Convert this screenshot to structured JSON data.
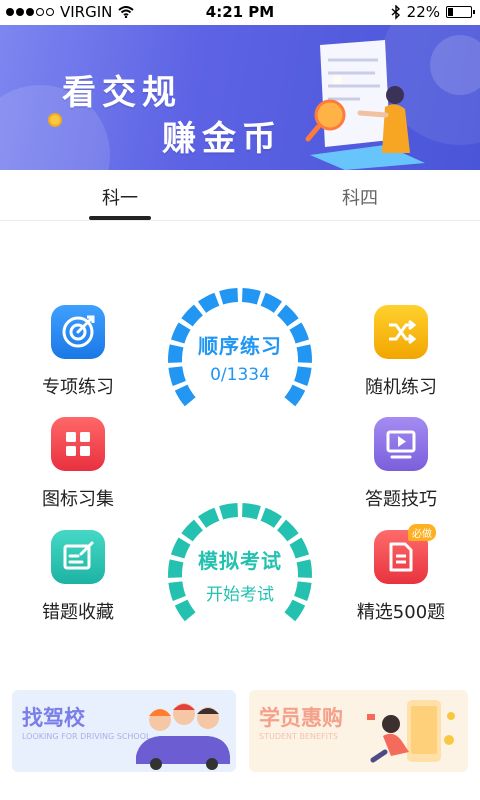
{
  "status_bar": {
    "carrier": "VIRGIN",
    "time": "4:21 PM",
    "battery": "22%",
    "battery_level": 0.22
  },
  "banner": {
    "line1": "看交规",
    "line2": "赚金币"
  },
  "tabs": [
    {
      "label": "科一",
      "active": true
    },
    {
      "label": "科四",
      "active": false
    }
  ],
  "features": {
    "special_practice": {
      "label": "专项练习",
      "icon": "target-icon",
      "color": "#2d8cf0"
    },
    "random_practice": {
      "label": "随机练习",
      "icon": "shuffle-icon",
      "color": "#f5b400"
    },
    "sign_collection": {
      "label": "图标习集",
      "icon": "grid-icon",
      "color": "#f0464e"
    },
    "answer_tips": {
      "label": "答题技巧",
      "icon": "play-screen-icon",
      "color": "#8b6fe0"
    },
    "wrong_questions": {
      "label": "错题收藏",
      "icon": "edit-icon",
      "color": "#2cc6b6"
    },
    "selected_500": {
      "label": "精选500题",
      "icon": "document-icon",
      "color": "#f0464e",
      "badge": "必做"
    }
  },
  "sequential": {
    "title": "顺序练习",
    "progress": "0/1334",
    "color": "#2196f3"
  },
  "mock_exam": {
    "title": "模拟考试",
    "subtitle": "开始考试",
    "color": "#25c1b0"
  },
  "cards": {
    "driving_school": {
      "title": "找驾校",
      "subtitle": "LOOKING FOR DRIVING SCHOOL"
    },
    "student_benefits": {
      "title": "学员惠购",
      "subtitle": "STUDENT BENEFITS"
    }
  }
}
